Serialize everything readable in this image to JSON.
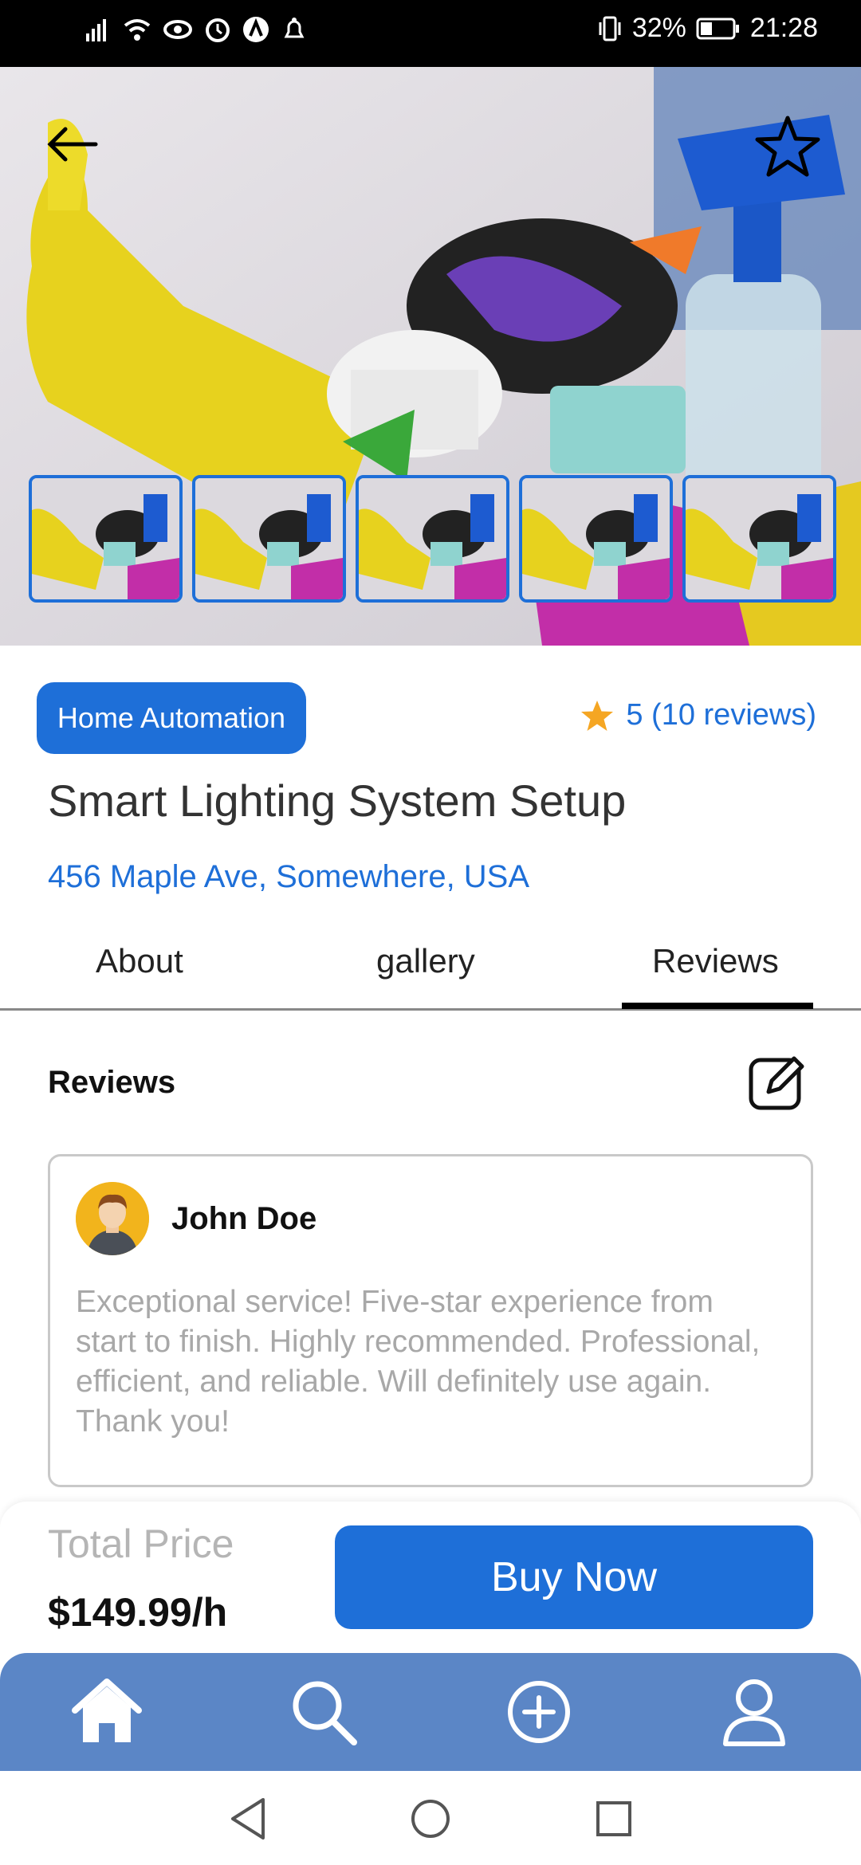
{
  "status_bar": {
    "battery_percent": "32%",
    "time": "21:28"
  },
  "hero": {
    "image": "cleaning-supplies-photo",
    "thumbnails_count": 5
  },
  "listing": {
    "category_chip": "Home Automation",
    "rating_text": "5 (10 reviews)",
    "title": "Smart Lighting System Setup",
    "address": "456 Maple Ave, Somewhere, USA"
  },
  "tabs": [
    {
      "label": "About"
    },
    {
      "label": "gallery"
    },
    {
      "label": "Reviews"
    }
  ],
  "reviews": {
    "heading": "Reviews",
    "items": [
      {
        "name": "John Doe",
        "text": "Exceptional service! Five-star experience from start to finish. Highly recommended. Professional, efficient, and reliable. Will definitely use again. Thank you!"
      }
    ]
  },
  "purchase": {
    "total_label": "Total Price",
    "price": "$149.99/h",
    "buy_label": "Buy Now"
  },
  "bottom_nav": [
    {
      "icon": "home-icon"
    },
    {
      "icon": "search-icon"
    },
    {
      "icon": "add-circle-icon"
    },
    {
      "icon": "profile-icon"
    }
  ],
  "colors": {
    "accent": "#1e6fd8",
    "nav_bg": "#5b86c6",
    "star": "#f5a623"
  }
}
